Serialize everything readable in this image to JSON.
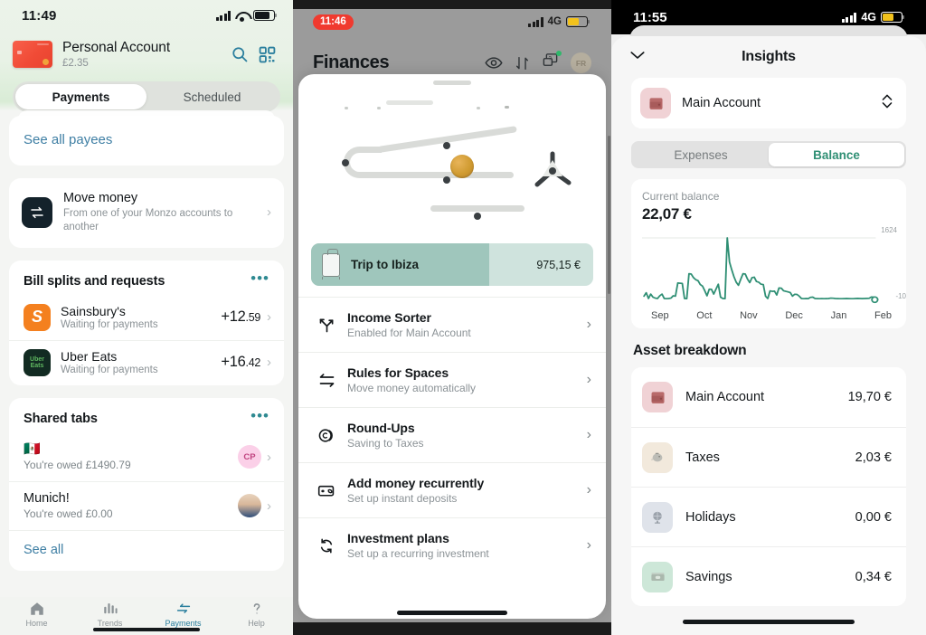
{
  "panel1": {
    "status": {
      "time": "11:49"
    },
    "account": {
      "name": "Personal Account",
      "balance": "£2.35"
    },
    "tabs": [
      {
        "label": "Payments",
        "active": true
      },
      {
        "label": "Scheduled",
        "active": false
      }
    ],
    "see_all_payees": "See all payees",
    "move_money": {
      "title": "Move money",
      "subtitle": "From one of your Monzo accounts to another"
    },
    "bill_splits": {
      "title": "Bill splits and requests",
      "rows": [
        {
          "name": "Sainsbury's",
          "sub": "Waiting for payments",
          "amount_major": "+12",
          "amount_minor": ".59",
          "icon": "sainsburys-logo"
        },
        {
          "name": "Uber Eats",
          "sub": "Waiting for payments",
          "amount_major": "+16",
          "amount_minor": ".42",
          "icon": "ubereats-logo"
        }
      ]
    },
    "shared_tabs": {
      "title": "Shared tabs",
      "rows": [
        {
          "name": "🇲🇽",
          "sub": "You're owed £1490.79",
          "avatar": "CP"
        },
        {
          "name": "Munich!",
          "sub": "You're owed £0.00",
          "avatar": "photo"
        }
      ],
      "see_all": "See all"
    },
    "nav": [
      {
        "label": "Home",
        "icon": "home-icon",
        "active": false
      },
      {
        "label": "Trends",
        "icon": "bar-chart-icon",
        "active": false
      },
      {
        "label": "Payments",
        "icon": "transfer-arrows-icon",
        "active": true
      },
      {
        "label": "Help",
        "icon": "question-mark-icon",
        "active": false
      }
    ]
  },
  "panel2": {
    "status": {
      "time": "11:46",
      "network": "4G"
    },
    "title": "Finances",
    "header_icons": [
      "eye-icon",
      "sort-arrows-icon",
      "help-chat-icon",
      "avatar-fr"
    ],
    "avatar_initials": "FR",
    "goal": {
      "name": "Trip to Ibiza",
      "amount": "975,15 €",
      "icon": "suitcase-icon"
    },
    "rows": [
      {
        "title": "Income Sorter",
        "sub": "Enabled for Main Account",
        "icon": "split-arrows-icon"
      },
      {
        "title": "Rules for Spaces",
        "sub": "Move money automatically",
        "icon": "two-way-arrows-icon"
      },
      {
        "title": "Round-Ups",
        "sub": "Saving to Taxes",
        "icon": "coin-icon"
      },
      {
        "title": "Add money recurrently",
        "sub": "Set up instant deposits",
        "icon": "card-refresh-icon"
      },
      {
        "title": "Investment plans",
        "sub": "Set up a recurring investment",
        "icon": "refresh-circle-icon"
      }
    ]
  },
  "panel3": {
    "status": {
      "time": "11:55",
      "network": "4G"
    },
    "title": "Insights",
    "account_selector": {
      "name": "Main Account",
      "icon": "wallet-icon"
    },
    "segments": [
      {
        "label": "Expenses",
        "active": false
      },
      {
        "label": "Balance",
        "active": true
      }
    ],
    "balance_card": {
      "label": "Current balance",
      "value": "22,07 €"
    },
    "asset_breakdown": {
      "title": "Asset breakdown",
      "rows": [
        {
          "name": "Main Account",
          "amount": "19,70 €",
          "icon": "wallet-icon",
          "tile": "pink"
        },
        {
          "name": "Taxes",
          "amount": "2,03 €",
          "icon": "piggy-bank-icon",
          "tile": "beige"
        },
        {
          "name": "Holidays",
          "amount": "0,00 €",
          "icon": "globe-icon",
          "tile": "blue"
        },
        {
          "name": "Savings",
          "amount": "0,34 €",
          "icon": "savings-icon",
          "tile": "green"
        }
      ]
    }
  },
  "chart_data": {
    "type": "line",
    "title": "Current balance",
    "xlabel": "",
    "ylabel": "",
    "ylim": [
      -10,
      1624
    ],
    "ymax_label": "1624",
    "ymin_label": "-10",
    "grid": false,
    "legend": "none",
    "line_color": "#2f8f74",
    "tick_labels": [
      "Sep",
      "Oct",
      "Nov",
      "Dec",
      "Jan",
      "Feb"
    ],
    "end_marker": true,
    "values": [
      120,
      210,
      60,
      175,
      95,
      70,
      60,
      130,
      175,
      60,
      55,
      60,
      70,
      130,
      120,
      460,
      455,
      450,
      60,
      55,
      700,
      690,
      600,
      545,
      520,
      420,
      380,
      260,
      130,
      300,
      295,
      175,
      300,
      430,
      95,
      60,
      55,
      1624,
      1000,
      800,
      620,
      480,
      400,
      560,
      700,
      690,
      560,
      470,
      600,
      610,
      500,
      480,
      430,
      420,
      120,
      60,
      255,
      245,
      250,
      150,
      330,
      325,
      260,
      245,
      230,
      215,
      120,
      170,
      165,
      120,
      60,
      55,
      60,
      58,
      90,
      95,
      60,
      58,
      55,
      57,
      56,
      58,
      60,
      70,
      68,
      60,
      58,
      56,
      55,
      58,
      60,
      58,
      56,
      55,
      60,
      62,
      60,
      58,
      60,
      62,
      65,
      100,
      95,
      30
    ]
  }
}
